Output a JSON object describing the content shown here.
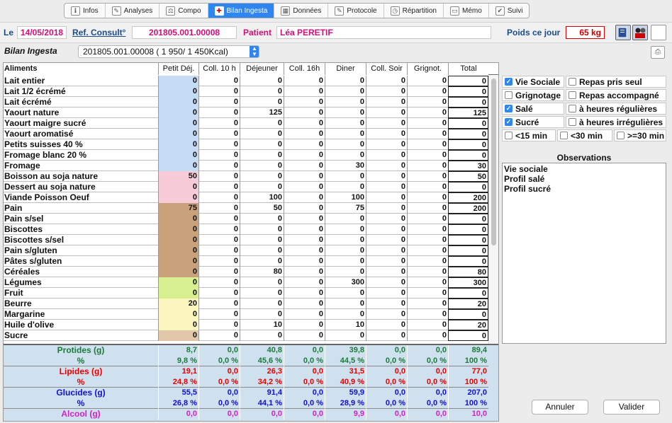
{
  "tabs": [
    {
      "label": "Infos",
      "icon": "info-icon",
      "glyph": "ℹ",
      "active": false
    },
    {
      "label": "Analyses",
      "icon": "pen-icon",
      "glyph": "✎",
      "active": false
    },
    {
      "label": "Compo",
      "icon": "scale-icon",
      "glyph": "⚖",
      "active": false
    },
    {
      "label": "Bilan Ingesta",
      "icon": "doctor-icon",
      "glyph": "✚",
      "active": true
    },
    {
      "label": "Données",
      "icon": "table-icon",
      "glyph": "▦",
      "active": false
    },
    {
      "label": "Protocole",
      "icon": "document-icon",
      "glyph": "✎",
      "active": false
    },
    {
      "label": "Répartition",
      "icon": "clock-icon",
      "glyph": "◷",
      "active": false
    },
    {
      "label": "Mémo",
      "icon": "folder-icon",
      "glyph": "▭",
      "active": false
    },
    {
      "label": "Suivi",
      "icon": "checklist-icon",
      "glyph": "✔",
      "active": false
    }
  ],
  "header": {
    "date_label": "Le",
    "date": "14/05/2018",
    "ref_label": "Ref. Consult°",
    "ref": "201805.001.00008",
    "patient_label": "Patient",
    "patient": "Léa PERETIF",
    "weight_label": "Poids ce jour",
    "weight": "65 kg"
  },
  "bilan": {
    "label": "Bilan Ingesta",
    "selected": "201805.001.00008 ( 1 950/ 1 450Kcal)"
  },
  "columns": [
    "Aliments",
    "Petit Déj.",
    "Coll. 10 h",
    "Déjeuner",
    "Coll. 16h",
    "Diner",
    "Coll. Soir",
    "Grignot.",
    "Total"
  ],
  "rows": [
    {
      "name": "Lait entier",
      "vals": [
        "0",
        "0",
        "0",
        "0",
        "0",
        "0",
        "0",
        "0"
      ],
      "color": "#c6dcf6"
    },
    {
      "name": "Lait 1/2 écrémé",
      "vals": [
        "0",
        "0",
        "0",
        "0",
        "0",
        "0",
        "0",
        "0"
      ],
      "color": "#c6dcf6"
    },
    {
      "name": "Lait écrémé",
      "vals": [
        "0",
        "0",
        "0",
        "0",
        "0",
        "0",
        "0",
        "0"
      ],
      "color": "#c6dcf6"
    },
    {
      "name": "Yaourt nature",
      "vals": [
        "0",
        "0",
        "125",
        "0",
        "0",
        "0",
        "0",
        "125"
      ],
      "color": "#c6dcf6"
    },
    {
      "name": "Yaourt maigre sucré",
      "vals": [
        "0",
        "0",
        "0",
        "0",
        "0",
        "0",
        "0",
        "0"
      ],
      "color": "#c6dcf6"
    },
    {
      "name": "Yaourt aromatisé",
      "vals": [
        "0",
        "0",
        "0",
        "0",
        "0",
        "0",
        "0",
        "0"
      ],
      "color": "#c6dcf6"
    },
    {
      "name": "Petits suisses 40 %",
      "vals": [
        "0",
        "0",
        "0",
        "0",
        "0",
        "0",
        "0",
        "0"
      ],
      "color": "#c6dcf6"
    },
    {
      "name": "Fromage blanc 20 %",
      "vals": [
        "0",
        "0",
        "0",
        "0",
        "0",
        "0",
        "0",
        "0"
      ],
      "color": "#c6dcf6"
    },
    {
      "name": "Fromage",
      "vals": [
        "0",
        "0",
        "0",
        "0",
        "30",
        "0",
        "0",
        "30"
      ],
      "color": "#c6dcf6"
    },
    {
      "name": "Boisson au soja nature",
      "vals": [
        "50",
        "0",
        "0",
        "0",
        "0",
        "0",
        "0",
        "50"
      ],
      "color": "#f7ccd8"
    },
    {
      "name": "Dessert au soja nature",
      "vals": [
        "0",
        "0",
        "0",
        "0",
        "0",
        "0",
        "0",
        "0"
      ],
      "color": "#f7ccd8"
    },
    {
      "name": "Viande Poisson Oeuf",
      "vals": [
        "0",
        "0",
        "100",
        "0",
        "100",
        "0",
        "0",
        "200"
      ],
      "color": "#f7ccd8"
    },
    {
      "name": "Pain",
      "vals": [
        "75",
        "0",
        "50",
        "0",
        "75",
        "0",
        "0",
        "200"
      ],
      "color": "#c9a27c"
    },
    {
      "name": "Pain s/sel",
      "vals": [
        "0",
        "0",
        "0",
        "0",
        "0",
        "0",
        "0",
        "0"
      ],
      "color": "#c9a27c"
    },
    {
      "name": "Biscottes",
      "vals": [
        "0",
        "0",
        "0",
        "0",
        "0",
        "0",
        "0",
        "0"
      ],
      "color": "#c9a27c"
    },
    {
      "name": "Biscottes s/sel",
      "vals": [
        "0",
        "0",
        "0",
        "0",
        "0",
        "0",
        "0",
        "0"
      ],
      "color": "#c9a27c"
    },
    {
      "name": "Pain s/gluten",
      "vals": [
        "0",
        "0",
        "0",
        "0",
        "0",
        "0",
        "0",
        "0"
      ],
      "color": "#c9a27c"
    },
    {
      "name": "Pâtes s/gluten",
      "vals": [
        "0",
        "0",
        "0",
        "0",
        "0",
        "0",
        "0",
        "0"
      ],
      "color": "#c9a27c"
    },
    {
      "name": "Céréales",
      "vals": [
        "0",
        "0",
        "80",
        "0",
        "0",
        "0",
        "0",
        "80"
      ],
      "color": "#c9a27c"
    },
    {
      "name": "Légumes",
      "vals": [
        "0",
        "0",
        "0",
        "0",
        "300",
        "0",
        "0",
        "300"
      ],
      "color": "#d7ef8e"
    },
    {
      "name": "Fruit",
      "vals": [
        "0",
        "0",
        "0",
        "0",
        "0",
        "0",
        "0",
        "0"
      ],
      "color": "#d7ef8e"
    },
    {
      "name": "Beurre",
      "vals": [
        "20",
        "0",
        "0",
        "0",
        "0",
        "0",
        "0",
        "20"
      ],
      "color": "#fbf6c0"
    },
    {
      "name": "Margarine",
      "vals": [
        "0",
        "0",
        "0",
        "0",
        "0",
        "0",
        "0",
        "0"
      ],
      "color": "#fbf6c0"
    },
    {
      "name": "Huile d'olive",
      "vals": [
        "0",
        "0",
        "10",
        "0",
        "10",
        "0",
        "0",
        "20"
      ],
      "color": "#fbf6c0"
    },
    {
      "name": "Sucre",
      "vals": [
        "0",
        "0",
        "0",
        "0",
        "0",
        "0",
        "0",
        "0"
      ],
      "color": "#e2c6a8"
    }
  ],
  "summary": [
    {
      "name": "Protides (g)",
      "vals": [
        "8,7",
        "0,0",
        "40,8",
        "0,0",
        "39,8",
        "0,0",
        "0,0",
        "89,4"
      ],
      "color": "#1a7a3a"
    },
    {
      "name": "%",
      "vals": [
        "9,8 %",
        "0,0 %",
        "45,6 %",
        "0,0 %",
        "44,5 %",
        "0,0 %",
        "0,0 %",
        "100 %"
      ],
      "color": "#1a7a3a",
      "sep": true
    },
    {
      "name": "Lipides (g)",
      "vals": [
        "19,1",
        "0,0",
        "26,3",
        "0,0",
        "31,5",
        "0,0",
        "0,0",
        "77,0"
      ],
      "color": "#e60000"
    },
    {
      "name": "%",
      "vals": [
        "24,8 %",
        "0,0 %",
        "34,2 %",
        "0,0 %",
        "40,9 %",
        "0,0 %",
        "0,0 %",
        "100 %"
      ],
      "color": "#e60000",
      "sep": true
    },
    {
      "name": "Glucides (g)",
      "vals": [
        "55,5",
        "0,0",
        "91,4",
        "0,0",
        "59,9",
        "0,0",
        "0,0",
        "207,0"
      ],
      "color": "#1010d0"
    },
    {
      "name": "%",
      "vals": [
        "26,8 %",
        "0,0 %",
        "44,1 %",
        "0,0 %",
        "28,9 %",
        "0,0 %",
        "0,0 %",
        "100 %"
      ],
      "color": "#1010d0",
      "sep": true
    },
    {
      "name": "Alcool (g)",
      "vals": [
        "0,0",
        "0,0",
        "0,0",
        "0,0",
        "9,9",
        "0,0",
        "0,0",
        "10,0"
      ],
      "color": "#d020c8"
    }
  ],
  "checks": {
    "vie_sociale": {
      "label": "Vie Sociale",
      "checked": true
    },
    "repas_seul": {
      "label": "Repas pris seul",
      "checked": false
    },
    "grignotage": {
      "label": "Grignotage",
      "checked": false
    },
    "repas_accompagne": {
      "label": "Repas accompagné",
      "checked": false
    },
    "sale": {
      "label": "Salé",
      "checked": true
    },
    "heures_regulieres": {
      "label": "à heures régulières",
      "checked": false
    },
    "sucre": {
      "label": "Sucré",
      "checked": true
    },
    "heures_irregulieres": {
      "label": "à heures irrégulières",
      "checked": false
    },
    "lt15": {
      "label": "<15 min",
      "checked": false
    },
    "lt30": {
      "label": "<30 min",
      "checked": false
    },
    "ge30": {
      "label": ">=30 min",
      "checked": false
    }
  },
  "observations": {
    "title": "Observations",
    "lines": [
      "Vie sociale",
      "Profil salé",
      "Profil sucré"
    ]
  },
  "buttons": {
    "cancel": "Annuler",
    "ok": "Valider"
  }
}
